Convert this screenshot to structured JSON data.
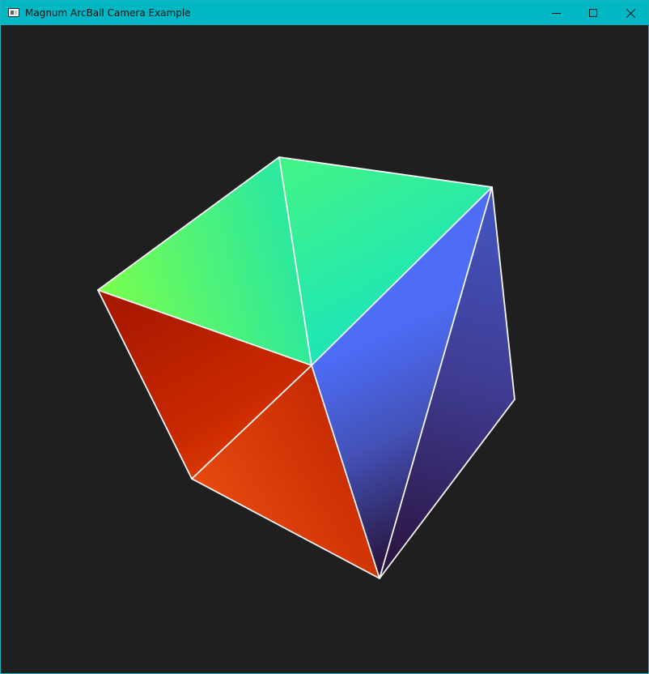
{
  "window": {
    "title": "Magnum ArcBall Camera Example",
    "title_bar_color": "#00b7c3",
    "background_color": "#1f1f1f"
  },
  "titlebar": {
    "icons": {
      "app": "window-app-icon",
      "minimize": "minimize-icon",
      "maximize": "maximize-icon",
      "close": "close-icon"
    }
  },
  "scene": {
    "object": "cube",
    "edge_color": "#f8f8f8",
    "face_colors": {
      "top": [
        "#7bff4b",
        "#45f27f",
        "#1fe6b1"
      ],
      "front_left": [
        "#a91800",
        "#c92b00",
        "#e74a10"
      ],
      "right": [
        "#4a68f0",
        "#3d45a2",
        "#2e1640"
      ]
    }
  }
}
